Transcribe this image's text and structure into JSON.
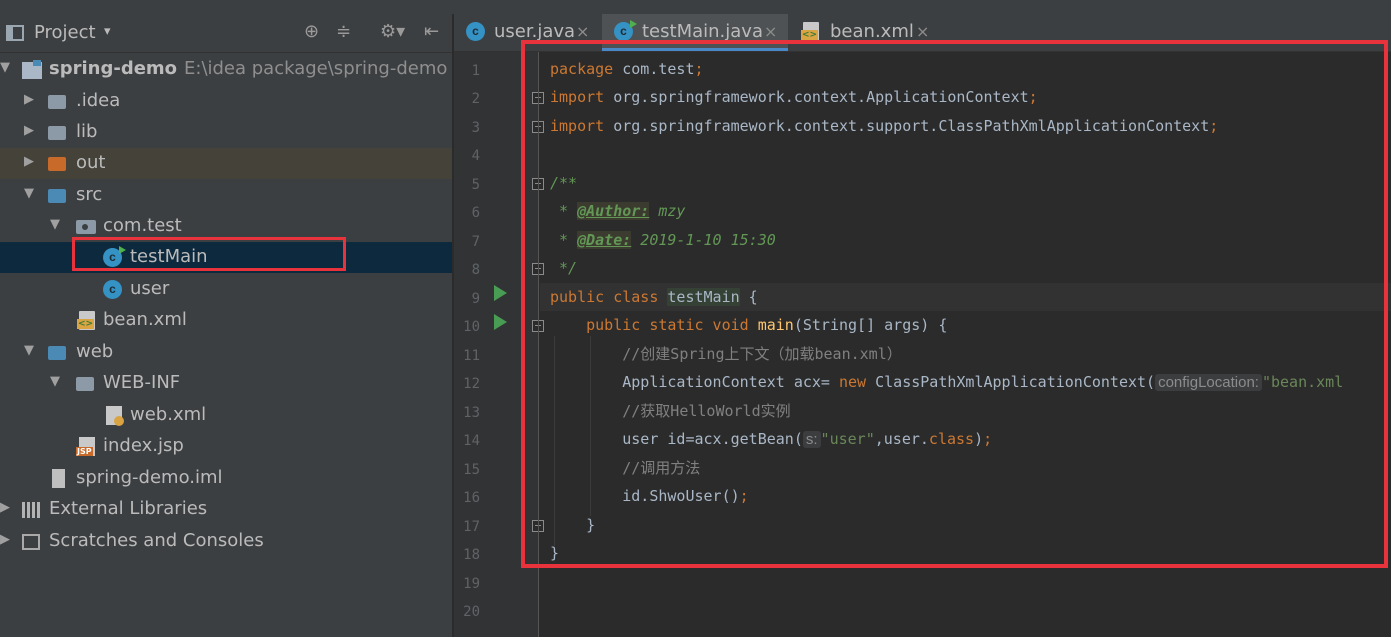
{
  "project_panel": {
    "title": "Project",
    "dropdown_glyph": "▾",
    "tools": [
      "⊕",
      "≑",
      "⚙▾",
      "⇤"
    ],
    "tree": [
      {
        "label": "spring-demo",
        "path": "E:\\idea package\\spring-demo",
        "arrow": "▼",
        "icon": "module-icon",
        "bold": true
      },
      {
        "label": ".idea",
        "arrow": "▶",
        "icon": "folder-icon"
      },
      {
        "label": "lib",
        "arrow": "▶",
        "icon": "folder-icon"
      },
      {
        "label": "out",
        "arrow": "▶",
        "icon": "excluded-folder-icon"
      },
      {
        "label": "src",
        "arrow": "▼",
        "icon": "source-folder-icon"
      },
      {
        "label": "com.test",
        "arrow": "▼",
        "icon": "package-icon"
      },
      {
        "label": "testMain",
        "icon": "java-class-runnable-icon",
        "selected": true
      },
      {
        "label": "user",
        "icon": "java-class-icon"
      },
      {
        "label": "bean.xml",
        "icon": "xml-file-icon"
      },
      {
        "label": "web",
        "arrow": "▼",
        "icon": "web-folder-icon"
      },
      {
        "label": "WEB-INF",
        "arrow": "▼",
        "icon": "folder-icon"
      },
      {
        "label": "web.xml",
        "icon": "web-xml-icon"
      },
      {
        "label": "index.jsp",
        "icon": "jsp-file-icon"
      },
      {
        "label": "spring-demo.iml",
        "icon": "iml-file-icon"
      },
      {
        "label": "External Libraries",
        "arrow": "▶",
        "icon": "libraries-icon"
      },
      {
        "label": "Scratches and Consoles",
        "arrow": "▶",
        "icon": "scratches-icon"
      }
    ]
  },
  "tabs": [
    {
      "label": "user.java",
      "close": "×",
      "icon": "java-class-icon"
    },
    {
      "label": "testMain.java",
      "close": "×",
      "icon": "java-class-runnable-icon",
      "active": true
    },
    {
      "label": "bean.xml",
      "close": "×",
      "icon": "xml-file-icon"
    }
  ],
  "editor": {
    "line_numbers": [
      "1",
      "2",
      "3",
      "4",
      "5",
      "6",
      "7",
      "8",
      "9",
      "10",
      "11",
      "12",
      "13",
      "14",
      "15",
      "16",
      "17",
      "18",
      "19",
      "20"
    ],
    "code": {
      "l1_kw": "package",
      "l1_rest": " com.test",
      "l1_semi": ";",
      "l2_kw": "import",
      "l2_rest": " org.springframework.context.ApplicationContext",
      "l2_semi": ";",
      "l3_kw": "import",
      "l3_rest": " org.springframework.context.support.ClassPathXmlApplicationContext",
      "l3_semi": ";",
      "l5": "/**",
      "l6_star": " * ",
      "l6_tag": "@Author:",
      "l6_val": " mzy",
      "l7_star": " * ",
      "l7_tag": "@Date:",
      "l7_val": " 2019-1-10 15:30",
      "l8": " */",
      "l9_kw": "public class ",
      "l9_name": "testMain",
      "l9_rest": " {",
      "l10_kw": "    public static void ",
      "l10_fn": "main",
      "l10_rest": "(String[] args) {",
      "l11": "        //创建Spring上下文（加载bean.xml）",
      "l12_a": "        ApplicationContext acx= ",
      "l12_kw": "new",
      "l12_b": " ClassPathXmlApplicationContext(",
      "l12_hint": "configLocation:",
      "l12_str": "\"bean.xml",
      "l13": "        //获取HelloWorld实例",
      "l14_a": "        user id=acx.getBean(",
      "l14_hint": "s:",
      "l14_str": "\"user\"",
      "l14_b": ",user.",
      "l14_kw": "class",
      "l14_c": ")",
      "l14_semi": ";",
      "l15": "        //调用方法",
      "l16_a": "        id.ShwoUser()",
      "l16_semi": ";",
      "l17": "    }",
      "l18": "}"
    }
  },
  "colors": {
    "background": "#2b2b2b",
    "panel": "#3c3f41",
    "keyword": "#cc7832",
    "comment": "#808080",
    "doc": "#629755",
    "string": "#6a8759",
    "method": "#ffc66d",
    "highlight_box": "#e8323c",
    "selection": "#0d293e"
  }
}
